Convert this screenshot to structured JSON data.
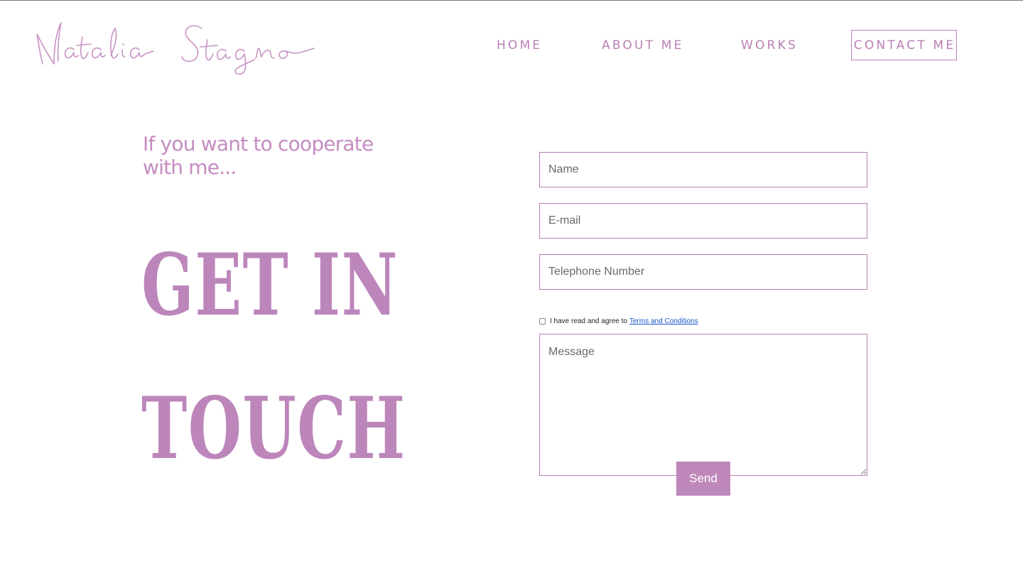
{
  "brand": {
    "logo_text": "Natalia Stagno",
    "accent_color": "#c088bc"
  },
  "nav": {
    "home": "HOME",
    "about": "ABOUT ME",
    "works": "WORKS",
    "contact": "CONTACT ME",
    "active": "CONTACT ME"
  },
  "hero": {
    "subtitle": "If you want to cooperate with me...",
    "heading_line1": "GET IN",
    "heading_line2": "TOUCH"
  },
  "form": {
    "name_placeholder": "Name",
    "email_placeholder": "E-mail",
    "phone_placeholder": "Telephone Number",
    "terms_text": "I have read and agree to",
    "terms_link": "Terms and Conditions",
    "terms_checked": false,
    "message_placeholder": "Message",
    "send_label": "Send"
  }
}
